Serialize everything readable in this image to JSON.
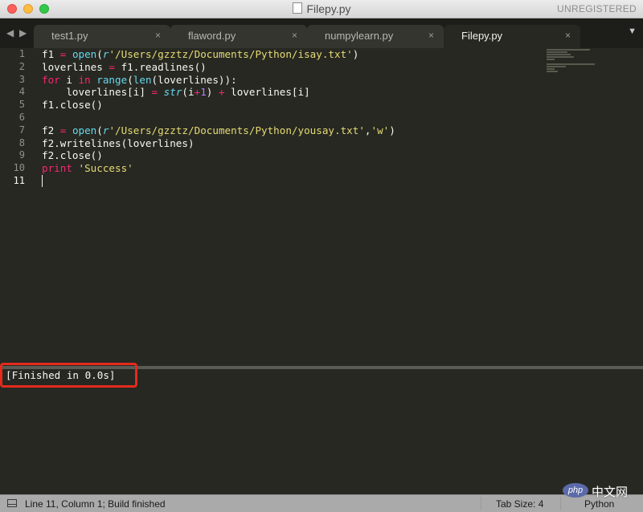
{
  "window": {
    "title": "Filepy.py",
    "registration": "UNREGISTERED"
  },
  "nav": {
    "back": "◀",
    "forward": "▶",
    "overflow": "▼"
  },
  "tabs": [
    {
      "label": "test1.py",
      "close": "×"
    },
    {
      "label": "flaword.py",
      "close": "×"
    },
    {
      "label": "numpylearn.py",
      "close": "×"
    },
    {
      "label": "Filepy.py",
      "close": "×"
    }
  ],
  "editor": {
    "line_numbers": [
      "1",
      "2",
      "3",
      "4",
      "5",
      "6",
      "7",
      "8",
      "9",
      "10",
      "11"
    ],
    "code": {
      "l1": {
        "a": "f1 ",
        "op": "=",
        "sp": " ",
        "fn": "open",
        "p1": "(",
        "r": "r",
        "str": "'/Users/gzztz/Documents/Python/isay.txt'",
        "p2": ")"
      },
      "l2": {
        "a": "loverlines ",
        "op": "=",
        "b": " f1.readlines()"
      },
      "l3": {
        "kw1": "for",
        "a": " i ",
        "kw2": "in",
        "sp": " ",
        "fn1": "range",
        "p1": "(",
        "fn2": "len",
        "b": "(loverlines)):"
      },
      "l4": {
        "a": "    loverlines[i] ",
        "op": "=",
        "sp": " ",
        "fn": "str",
        "b": "(i",
        "op2": "+",
        "num": "1",
        "c": ") ",
        "op3": "+",
        "d": " loverlines[i]"
      },
      "l5": {
        "a": "f1.close()"
      },
      "l6": {
        "a": ""
      },
      "l7": {
        "a": "f2 ",
        "op": "=",
        "sp": " ",
        "fn": "open",
        "p1": "(",
        "r": "r",
        "str1": "'/Users/gzztz/Documents/Python/yousay.txt'",
        "comma": ",",
        "str2": "'w'",
        "p2": ")"
      },
      "l8": {
        "a": "f2.writelines(loverlines)"
      },
      "l9": {
        "a": "f2.close()"
      },
      "l10": {
        "kw": "print",
        "sp": " ",
        "str": "'Success'"
      }
    }
  },
  "build_panel": {
    "output": "[Finished in 0.0s]"
  },
  "statusbar": {
    "position": "Line 11, Column 1; Build finished",
    "tab_size": "Tab Size: 4",
    "syntax": "Python"
  },
  "watermark": {
    "logo": "php",
    "text": "中文网"
  },
  "colors": {
    "background": "#272822",
    "keyword": "#f92672",
    "function": "#66d9ef",
    "string": "#e6db74",
    "number": "#ae81ff",
    "annotation": "#e52a1c"
  }
}
